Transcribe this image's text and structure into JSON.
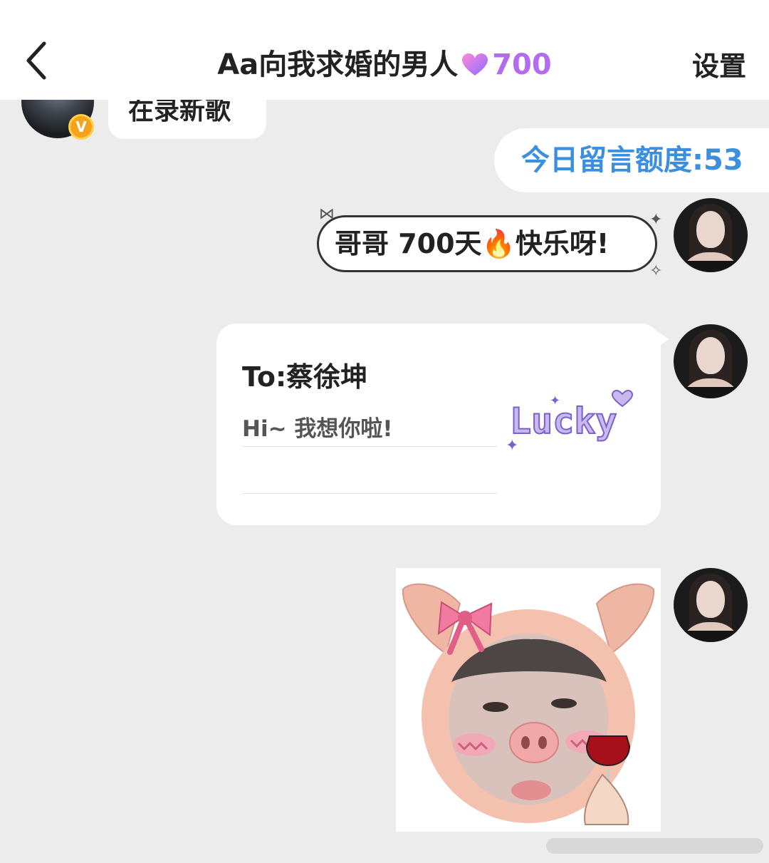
{
  "header": {
    "back_label": "<",
    "title": "Aa向我求婚的男人",
    "heart_count": "700",
    "settings_label": "设置"
  },
  "messages": {
    "other_text": "在录新歌",
    "vip_badge": "V",
    "quota_text": "今日留言额度:53",
    "bubble1_text": "哥哥 700天🔥快乐呀!",
    "card": {
      "to": "To:蔡徐坤",
      "message": "Hi~ 我想你啦!",
      "sticker_text": "Lucky"
    }
  },
  "colors": {
    "accent_blue": "#3b8fde",
    "heart_purple": "#b36cf0",
    "background": "#ececec"
  }
}
